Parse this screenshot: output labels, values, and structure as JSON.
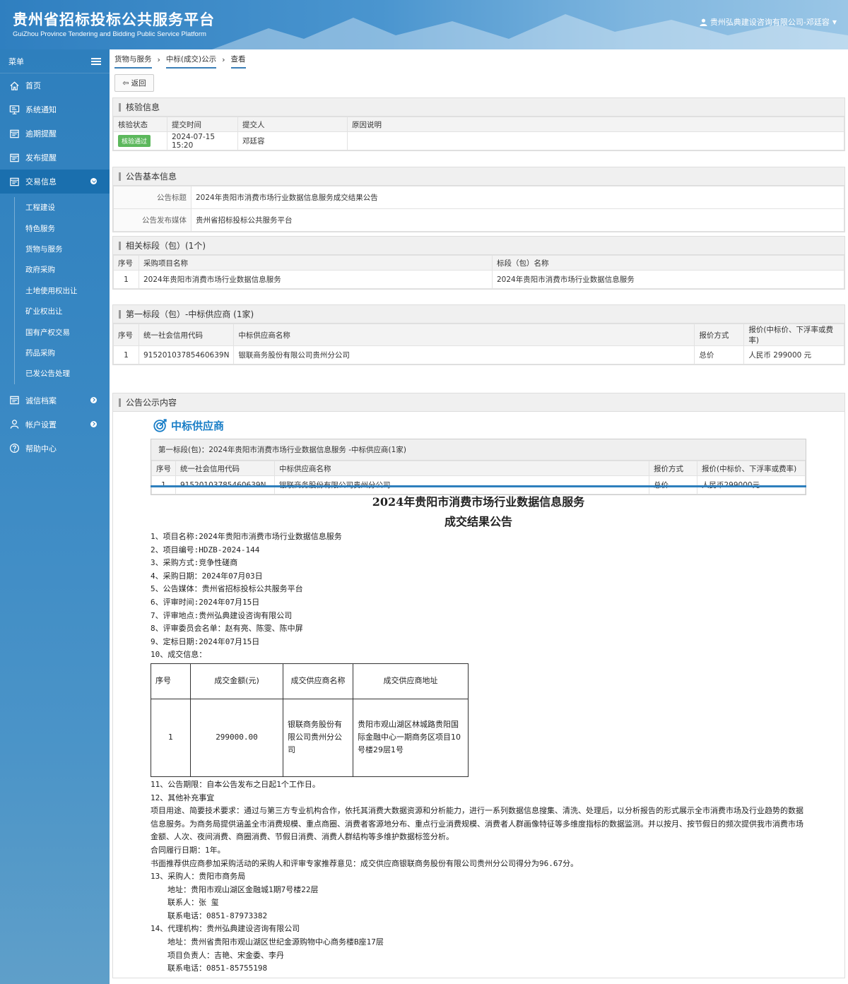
{
  "header": {
    "title_cn": "贵州省招标投标公共服务平台",
    "title_en": "GuiZhou Province Tendering and Bidding Public Service Platform",
    "user": "贵州弘典建设咨询有限公司-邓廷容"
  },
  "sidebar": {
    "menu_label": "菜单",
    "items": [
      {
        "label": "首页",
        "icon": "home-icon"
      },
      {
        "label": "系统通知",
        "icon": "monitor-icon"
      },
      {
        "label": "逾期提醒",
        "icon": "list-icon"
      },
      {
        "label": "发布提醒",
        "icon": "list-icon"
      },
      {
        "label": "交易信息",
        "icon": "list-icon"
      }
    ],
    "sub_items": [
      "工程建设",
      "特色服务",
      "货物与服务",
      "政府采购",
      "土地使用权出让",
      "矿业权出让",
      "国有产权交易",
      "药品采购",
      "已发公告处理"
    ],
    "bottom_items": [
      {
        "label": "诚信档案",
        "icon": "list-icon"
      },
      {
        "label": "帐户设置",
        "icon": "user-icon"
      },
      {
        "label": "帮助中心",
        "icon": "help-icon"
      }
    ]
  },
  "breadcrumb": [
    "货物与服务",
    "中标(成交)公示",
    "查看"
  ],
  "back_label": "返回",
  "verify": {
    "title": "核验信息",
    "headers": [
      "核验状态",
      "提交时间",
      "提交人",
      "原因说明"
    ],
    "status": "核验通过",
    "time": "2024-07-15 15:20",
    "submitter": "邓廷容",
    "reason": ""
  },
  "basic": {
    "title": "公告基本信息",
    "rows": [
      {
        "k": "公告标题",
        "v": "2024年贵阳市消费市场行业数据信息服务成交结果公告"
      },
      {
        "k": "公告发布媒体",
        "v": "贵州省招标投标公共服务平台"
      }
    ]
  },
  "segments": {
    "title": "相关标段（包）(1个)",
    "headers": [
      "序号",
      "采购项目名称",
      "标段（包）名称"
    ],
    "rows": [
      [
        "1",
        "2024年贵阳市消费市场行业数据信息服务",
        "2024年贵阳市消费市场行业数据信息服务"
      ]
    ]
  },
  "winner": {
    "title": "第一标段（包）-中标供应商 (1家)",
    "headers": [
      "序号",
      "统一社会信用代码",
      "中标供应商名称",
      "报价方式",
      "报价(中标价、下浮率或费率)"
    ],
    "rows": [
      [
        "1",
        "91520103785460639N",
        "银联商务股份有限公司贵州分公司",
        "总价",
        "人民币 299000 元"
      ]
    ]
  },
  "notice": {
    "title": "公告公示内容",
    "win_heading": "中标供应商",
    "box_title": "第一标段(包)：2024年贵阳市消费市场行业数据信息服务 -中标供应商(1家)",
    "headers": [
      "序号",
      "统一社会信用代码",
      "中标供应商名称",
      "报价方式",
      "报价(中标价、下浮率或费率)"
    ],
    "row": [
      "1",
      "91520103785460639N",
      "银联商务股份有限公司贵州分公司",
      "总价",
      "人民币299000元"
    ],
    "doc_title_1": "2024年贵阳市消费市场行业数据信息服务",
    "doc_title_2": "成交结果公告",
    "lines": [
      "1、项目名称:2024年贵阳市消费市场行业数据信息服务",
      "2、项目编号:HDZB-2024-144",
      "3、采购方式:竞争性磋商",
      "4、采购日期：2024年07月03日",
      "5、公告媒体：贵州省招标投标公共服务平台",
      "6、评审时间:2024年07月15日",
      "7、评审地点:贵州弘典建设咨询有限公司",
      "8、评审委员会名单：赵有亮、陈雯、陈中屏",
      "9、定标日期:2024年07月15日",
      "10、成交信息："
    ],
    "deal": {
      "headers": [
        "序号",
        "成交金额(元)",
        "成交供应商名称",
        "成交供应商地址"
      ],
      "row": [
        "1",
        "299000.00",
        "银联商务股份有限公司贵州分公司",
        "贵阳市观山湖区林城路贵阳国际金融中心一期商务区项目10号楼29层1号"
      ]
    },
    "after": [
      "11、公告期限：自本公告发布之日起1个工作日。",
      "12、其他补充事宜"
    ],
    "para": "项目用途、简要技术要求：通过与第三方专业机构合作，依托其消费大数据资源和分析能力，进行一系列数据信息搜集、清洗、处理后，以分析报告的形式展示全市消费市场及行业趋势的数据信息服务。为商务局提供涵盖全市消费规模、重点商圈、消费者客源地分布、重点行业消费规模、消费者人群画像特征等多维度指标的数据监测。并以按月、按节假日的频次提供我市消费市场金额、人次、夜间消费、商圈消费、节假日消费、消费人群结构等多维护数据标签分析。",
    "contract": "合同履行日期：1年。",
    "recommend": "书面推荐供应商参加采购活动的采购人和评审专家推荐意见：成交供应商银联商务股份有限公司贵州分公司得分为96.67分。",
    "buyer": [
      "13、采购人：贵阳市商务局",
      "地址：贵阳市观山湖区金融城1期7号楼22层",
      "联系人：张 玺",
      "联系电话：0851-87973382"
    ],
    "agent": [
      "14、代理机构：贵州弘典建设咨询有限公司",
      "地址：贵州省贵阳市观山湖区世纪金源购物中心商务楼B座17层",
      "项目负责人：吉艳、宋金委、李丹",
      "联系电话：0851-85755198"
    ]
  }
}
